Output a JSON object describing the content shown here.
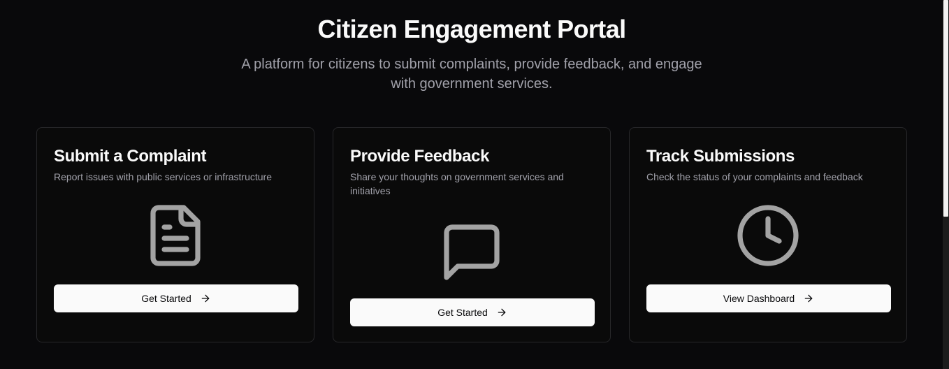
{
  "hero": {
    "title": "Citizen Engagement Portal",
    "subtitle": "A platform for citizens to submit complaints, provide feedback, and engage with government services."
  },
  "cards": [
    {
      "title": "Submit a Complaint",
      "description": "Report issues with public services or infrastructure",
      "icon": "file-text-icon",
      "button_label": "Get Started"
    },
    {
      "title": "Provide Feedback",
      "description": "Share your thoughts on government services and initiatives",
      "icon": "message-square-icon",
      "button_label": "Get Started"
    },
    {
      "title": "Track Submissions",
      "description": "Check the status of your complaints and feedback",
      "icon": "clock-icon",
      "button_label": "View Dashboard"
    }
  ],
  "colors": {
    "background": "#09090b",
    "card_border": "#27272a",
    "icon": "#a3a3a3",
    "button_bg": "#fafafa",
    "button_text": "#09090b",
    "muted_text": "#a1a1aa"
  }
}
